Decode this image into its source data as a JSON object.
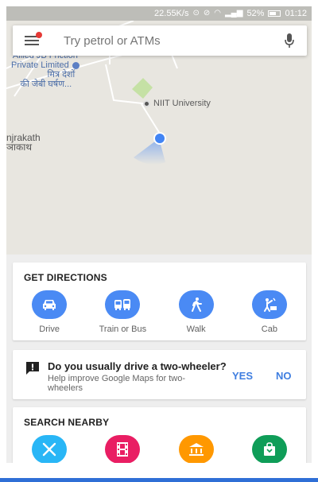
{
  "status_bar": {
    "speed": "22.55K/s",
    "battery": "52%",
    "time": "01:12"
  },
  "search": {
    "placeholder": "Try petrol or ATMs"
  },
  "map": {
    "labels": {
      "company_line1": "Allied JB Friction",
      "company_line2": "Private Limited",
      "company_hindi1": "मित्र देशों",
      "company_hindi2": "की जेबी घर्षण...",
      "university": "NIIT University",
      "town_en": "njrakath",
      "town_hi": "ञाकाथ"
    },
    "colors": {
      "background": "#e8e6e0",
      "park": "#c5e1a5",
      "road": "#ffffff",
      "location_dot": "#4285f4"
    }
  },
  "directions": {
    "title": "GET DIRECTIONS",
    "modes": [
      {
        "label": "Drive",
        "icon": "car-icon"
      },
      {
        "label": "Train or Bus",
        "icon": "bus-icon"
      },
      {
        "label": "Walk",
        "icon": "walk-icon"
      },
      {
        "label": "Cab",
        "icon": "cab-icon"
      }
    ],
    "accent": "#4a8af4"
  },
  "prompt": {
    "question": "Do you usually drive a two-wheeler?",
    "subtext": "Help improve Google Maps for two-wheelers",
    "yes": "YES",
    "no": "NO",
    "icon": "feedback-icon"
  },
  "nearby": {
    "title": "SEARCH NEARBY",
    "categories": [
      {
        "icon": "restaurant-icon",
        "color": "#29b6f6"
      },
      {
        "icon": "film-icon",
        "color": "#e91e63"
      },
      {
        "icon": "bank-icon",
        "color": "#ff9800"
      },
      {
        "icon": "shopping-bag-icon",
        "color": "#0f9d58"
      }
    ]
  }
}
